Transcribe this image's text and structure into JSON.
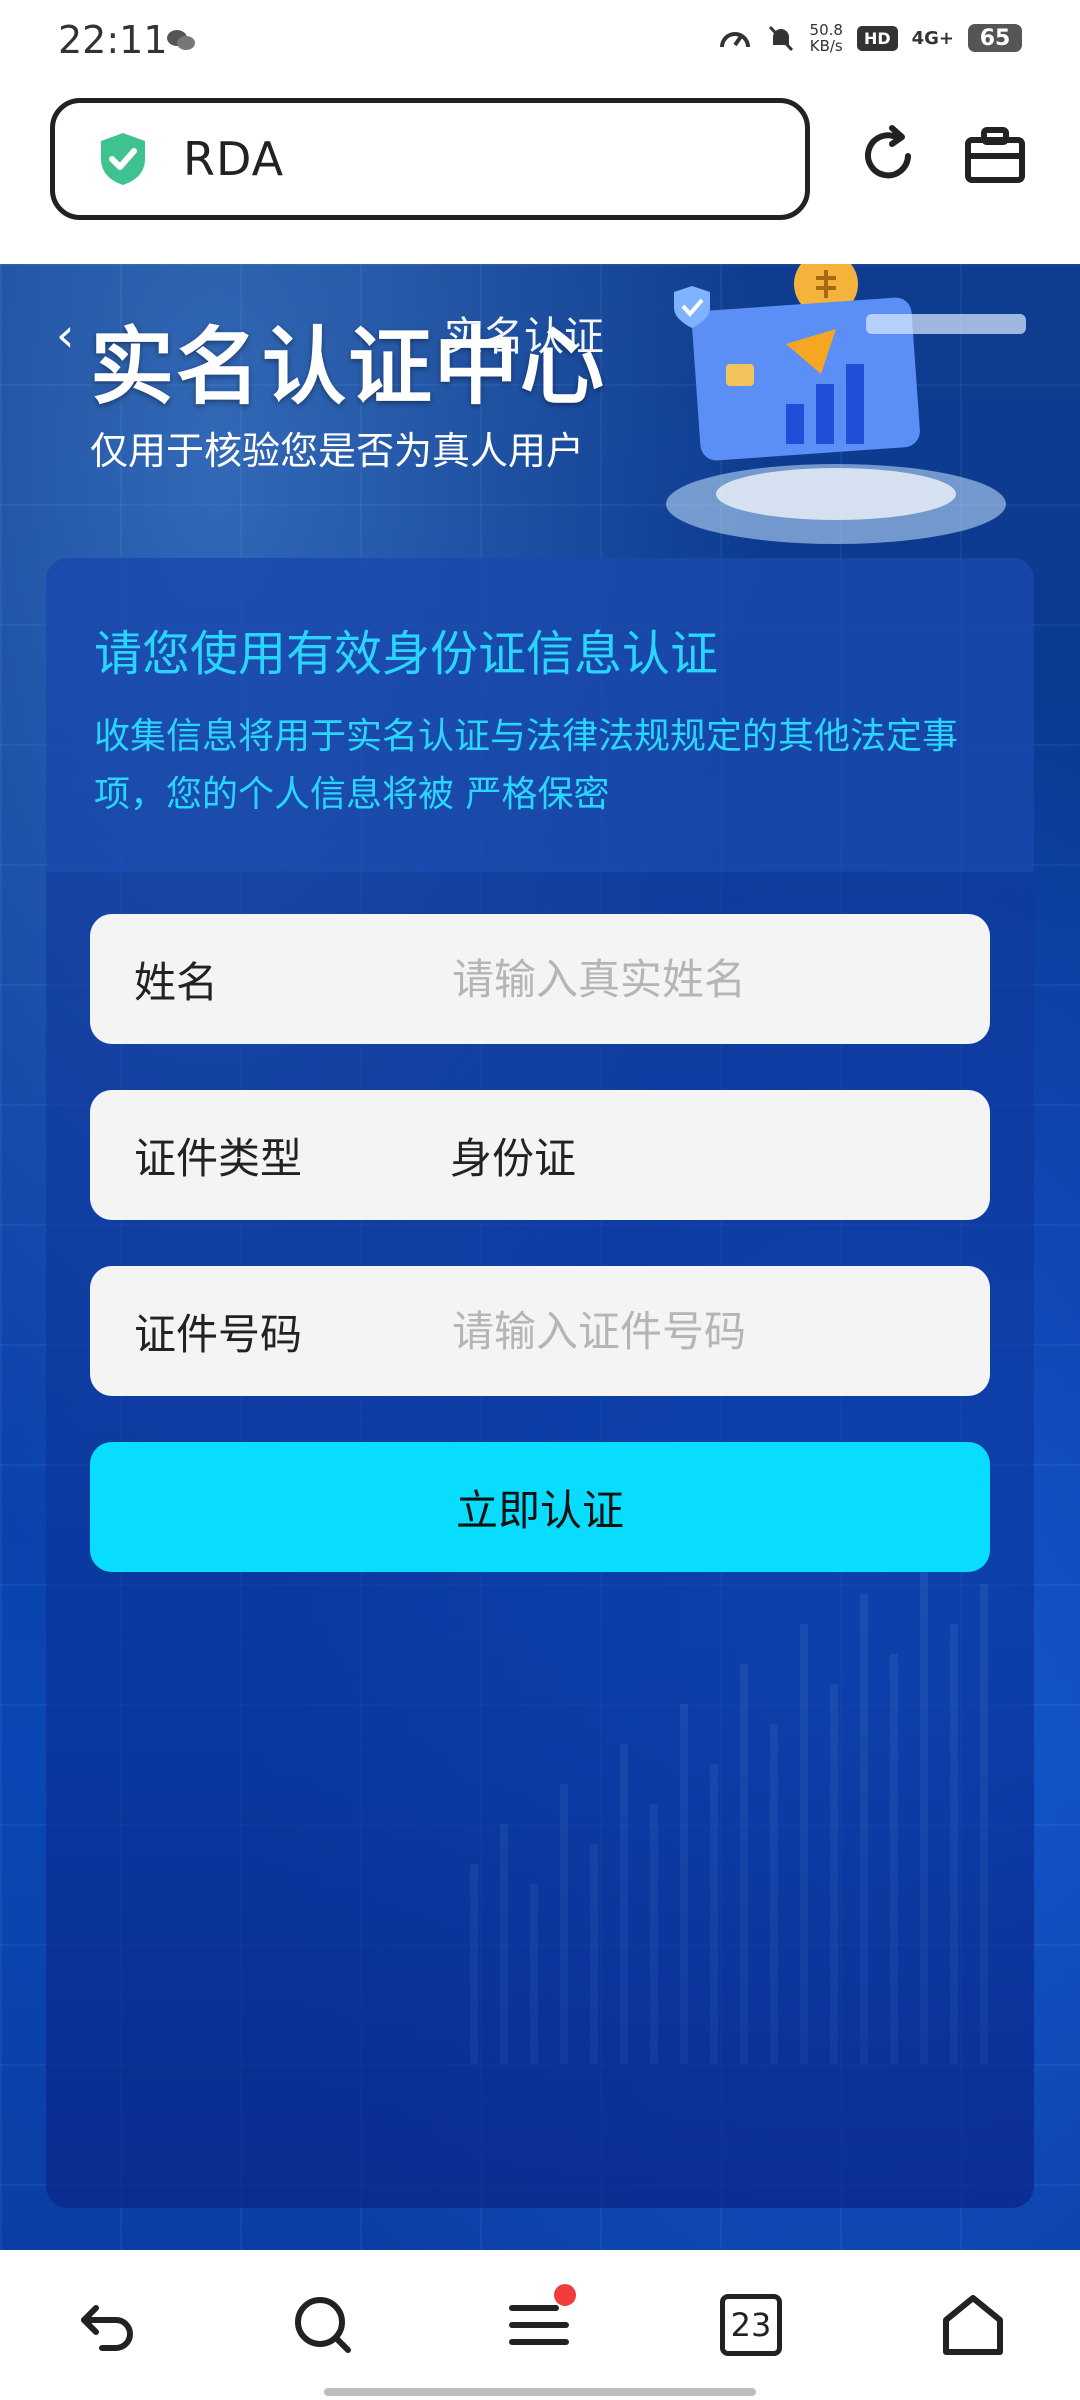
{
  "status": {
    "time": "22:11",
    "net_speed_top": "50.8",
    "net_speed_unit": "KB/s",
    "hd": "HD",
    "signal": "4G+",
    "battery": "65"
  },
  "browser": {
    "url": "RDA"
  },
  "hero": {
    "nav_title": "实名认证",
    "title": "实名认证中心",
    "subtitle": "仅用于核验您是否为真人用户"
  },
  "panel": {
    "title": "请您使用有效身份证信息认证",
    "description": "收集信息将用于实名认证与法律法规规定的其他法定事项，您的个人信息将被 严格保密"
  },
  "form": {
    "name_label": "姓名",
    "name_placeholder": "请输入真实姓名",
    "id_type_label": "证件类型",
    "id_type_value": "身份证",
    "id_number_label": "证件号码",
    "id_number_placeholder": "请输入证件号码",
    "submit_label": "立即认证"
  },
  "bottom_nav": {
    "tabs_count": "23"
  },
  "colors": {
    "accent": "#29d6ff",
    "button": "#08dcff",
    "shield": "#3ec28f"
  }
}
